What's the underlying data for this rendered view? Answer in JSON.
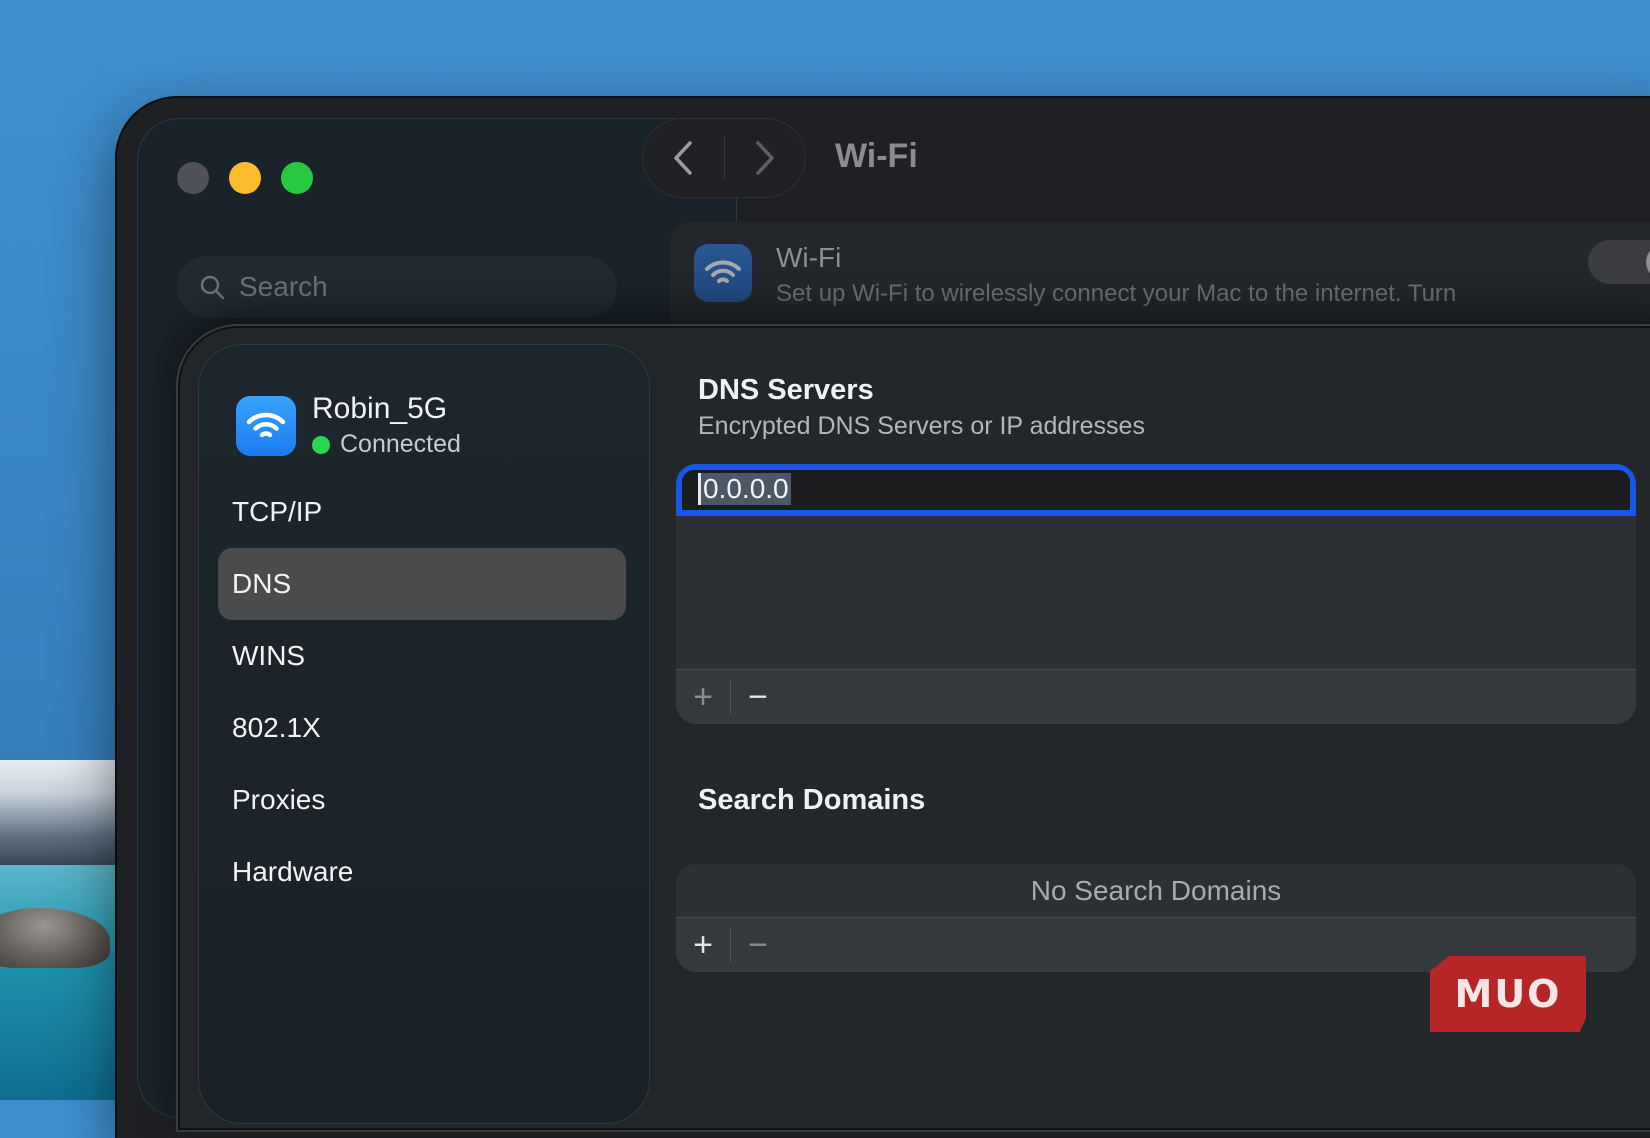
{
  "window": {
    "title": "Wi-Fi"
  },
  "back_sidebar": {
    "search_placeholder": "Search"
  },
  "wifi_card": {
    "title": "Wi-Fi",
    "description": "Set up Wi-Fi to wirelessly connect your Mac to the internet. Turn"
  },
  "network": {
    "name": "Robin_5G",
    "status": "Connected",
    "status_color": "#29d650"
  },
  "menu": [
    {
      "label": "TCP/IP"
    },
    {
      "label": "DNS",
      "active": true
    },
    {
      "label": "WINS"
    },
    {
      "label": "802.1X"
    },
    {
      "label": "Proxies"
    },
    {
      "label": "Hardware"
    }
  ],
  "dns_servers": {
    "title": "DNS Servers",
    "subtitle": "Encrypted DNS Servers or IP addresses",
    "entry_value": "0.0.0.0",
    "add_label": "+",
    "remove_label": "−"
  },
  "search_domains": {
    "title": "Search Domains",
    "empty_text": "No Search Domains",
    "add_label": "+",
    "remove_label": "−"
  },
  "watermark": {
    "text": "MUO"
  },
  "colors": {
    "accent": "#1958e6",
    "selection": "#4c5866"
  }
}
